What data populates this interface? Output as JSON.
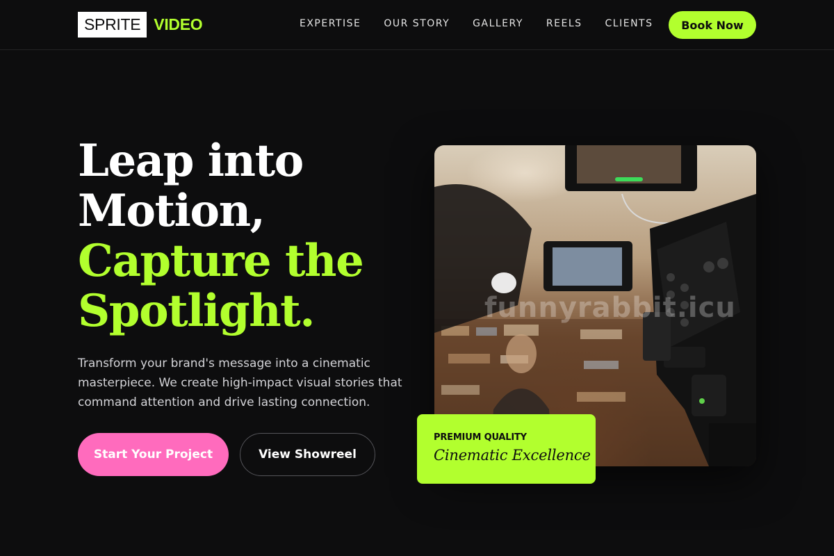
{
  "brand": {
    "name_boxed": "SPRITE",
    "name_accent": "VIDEO"
  },
  "nav": {
    "items": [
      {
        "label": "EXPERTISE"
      },
      {
        "label": "OUR STORY"
      },
      {
        "label": "GALLERY"
      },
      {
        "label": "REELS"
      },
      {
        "label": "CLIENTS"
      }
    ],
    "cta_label": "Book Now"
  },
  "hero": {
    "headline_line1": "Leap into",
    "headline_line2": "Motion,",
    "headline_line3": "Capture the",
    "headline_line4": "Spotlight.",
    "subtitle": "Transform your brand's message into a cinematic masterpiece. We create high-impact visual stories that command attention and drive lasting connection.",
    "primary_button": "Start Your Project",
    "secondary_button": "View Showreel",
    "image_watermark": "funnyrabbit.icu",
    "badge": {
      "label": "PREMIUM QUALITY",
      "title": "Cinematic Excellence"
    }
  },
  "colors": {
    "background": "#0d0d0e",
    "accent_green": "#b2ff2e",
    "accent_pink": "#ff6bbd",
    "text_primary": "#ffffff",
    "text_secondary": "#d4d4d8"
  }
}
